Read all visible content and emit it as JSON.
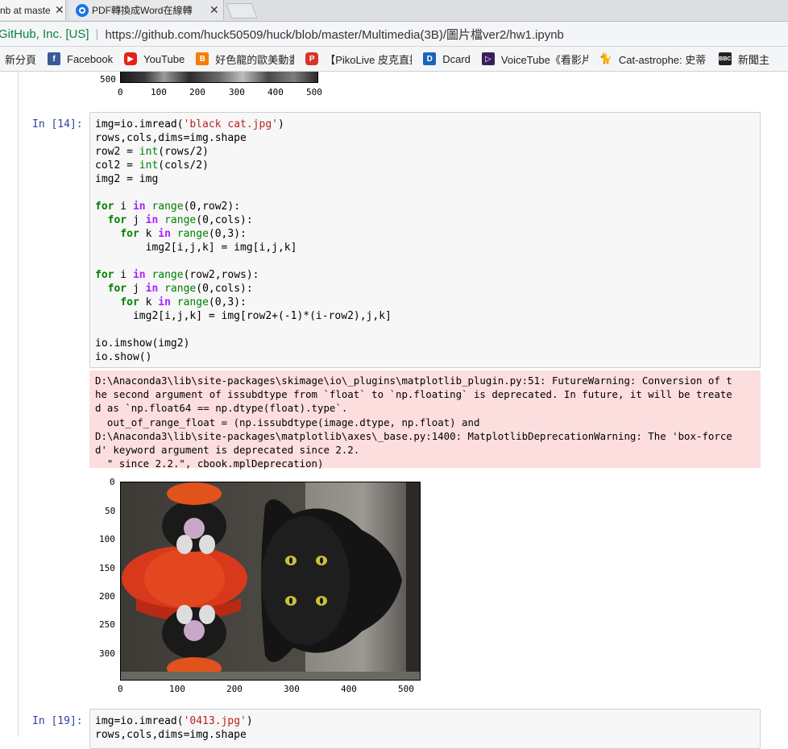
{
  "browser": {
    "tabs": [
      {
        "label": "nb at master",
        "close": "✕",
        "active": true
      },
      {
        "label": "PDF轉換成Word在線轉",
        "close": "✕",
        "active": false
      }
    ],
    "address": {
      "owner": "GitHub, Inc. [US]",
      "url": "https://github.com/huck50509/huck/blob/master/Multimedia(3B)/圖片檔ver2/hw1.ipynb"
    },
    "bookmarks": [
      {
        "label": "新分頁",
        "icon": "new-tab-icon"
      },
      {
        "label": "Facebook",
        "icon": "facebook-icon"
      },
      {
        "label": "YouTube",
        "icon": "youtube-icon"
      },
      {
        "label": "好色龍的歐美動畫",
        "icon": "blogger-icon"
      },
      {
        "label": "【PikoLive 皮克直播",
        "icon": "pikolive-icon"
      },
      {
        "label": "Dcard",
        "icon": "dcard-icon"
      },
      {
        "label": "VoiceTube《看影片",
        "icon": "voicetube-icon"
      },
      {
        "label": "Cat-astrophe: 史蒂",
        "icon": "cat-icon"
      },
      {
        "label": "新聞主",
        "icon": "bbc-icon"
      }
    ]
  },
  "notebook": {
    "prev_figure": {
      "y_tick": "500",
      "x_ticks": [
        "0",
        "100",
        "200",
        "300",
        "400",
        "500"
      ]
    },
    "cell14": {
      "prompt": "In [14]:",
      "code_lines": [
        "img=io.imread('black cat.jpg')",
        "rows,cols,dims=img.shape",
        "row2 = int(rows/2)",
        "col2 = int(cols/2)",
        "img2 = img",
        "",
        "for i in range(0,row2):",
        "  for j in range(0,cols):",
        "    for k in range(0,3):",
        "        img2[i,j,k] = img[i,j,k]",
        "",
        "for i in range(row2,rows):",
        "  for j in range(0,cols):",
        "    for k in range(0,3):",
        "      img2[i,j,k] = img[row2+(-1)*(i-row2),j,k]",
        "",
        "io.imshow(img2)",
        "io.show()"
      ],
      "stderr_lines": [
        "D:\\Anaconda3\\lib\\site-packages\\skimage\\io\\_plugins\\matplotlib_plugin.py:51: FutureWarning: Conversion of t",
        "he second argument of issubdtype from `float` to `np.floating` is deprecated. In future, it will be treate",
        "d as `np.float64 == np.dtype(float).type`.",
        "  out_of_range_float = (np.issubdtype(image.dtype, np.float) and",
        "D:\\Anaconda3\\lib\\site-packages\\matplotlib\\axes\\_base.py:1400: MatplotlibDeprecationWarning: The 'box-force",
        "d' keyword argument is deprecated since 2.2.",
        "  \" since 2.2.\", cbook.mplDeprecation)"
      ],
      "figure": {
        "y_ticks": [
          "0",
          "50",
          "100",
          "150",
          "200",
          "250",
          "300"
        ],
        "x_ticks": [
          "0",
          "100",
          "200",
          "300",
          "400",
          "500"
        ]
      }
    },
    "cell19": {
      "prompt": "In [19]:",
      "code_lines": [
        "img=io.imread('0413.jpg')",
        "rows,cols,dims=img.shape"
      ]
    }
  }
}
